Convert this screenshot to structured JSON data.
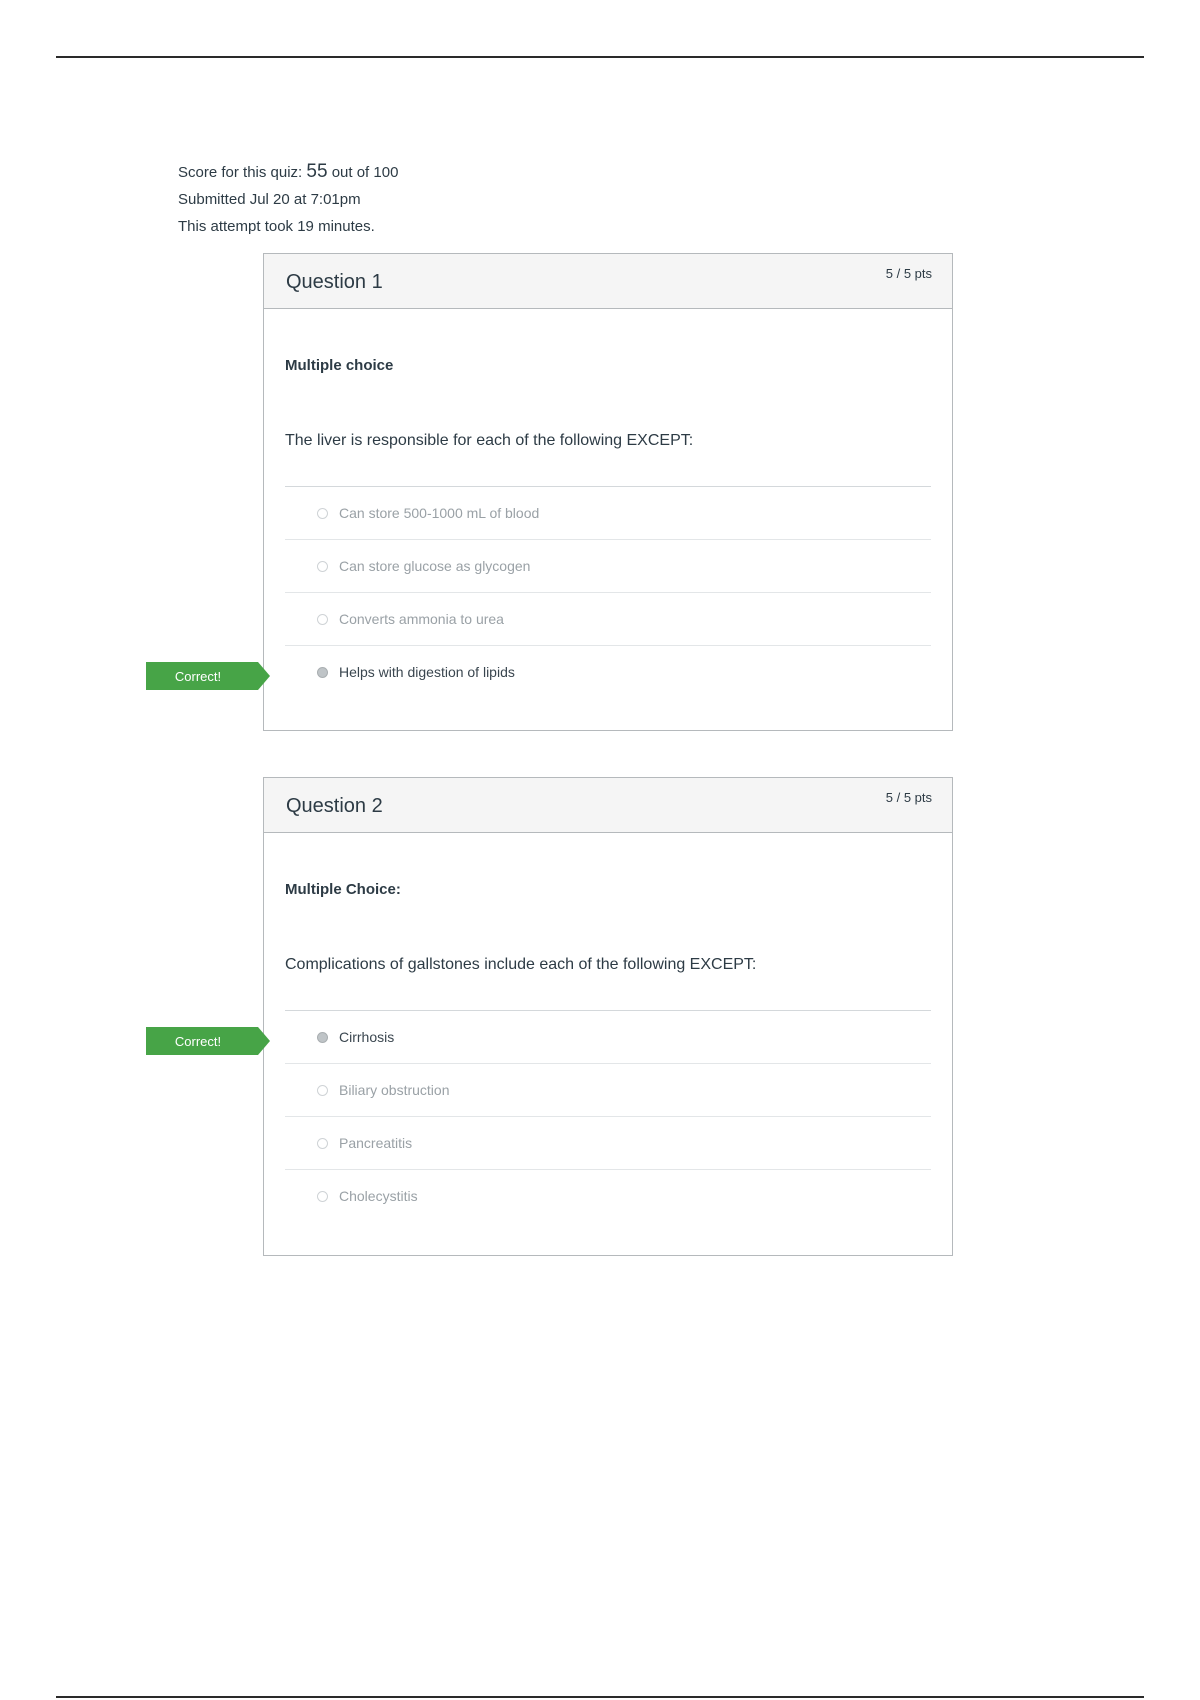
{
  "summary": {
    "score_prefix": "Score for this quiz: ",
    "score_value": "55",
    "score_suffix": " out of 100",
    "submitted": "Submitted Jul 20 at 7:01pm",
    "duration": "This attempt took 19 minutes."
  },
  "questions": [
    {
      "title": "Question 1",
      "points": "5 / 5 pts",
      "type": "Multiple choice",
      "text": "The liver is responsible for each of the following EXCEPT:",
      "answers": [
        "Can store 500-1000 mL of blood",
        "Can store glucose as glycogen",
        "Converts ammonia to urea",
        "Helps with digestion of lipids"
      ],
      "selected_index": 3,
      "feedback": "Correct!"
    },
    {
      "title": "Question 2",
      "points": "5 / 5 pts",
      "type": "Multiple Choice:",
      "text": "Complications of gallstones include each of the following EXCEPT:",
      "answers": [
        "Cirrhosis",
        "Biliary obstruction",
        "Pancreatitis",
        "Cholecystitis"
      ],
      "selected_index": 0,
      "feedback": "Correct!"
    }
  ],
  "colors": {
    "correct_tag": "#47a447",
    "header_bg": "#f5f5f5",
    "border": "#b5b9bc"
  }
}
